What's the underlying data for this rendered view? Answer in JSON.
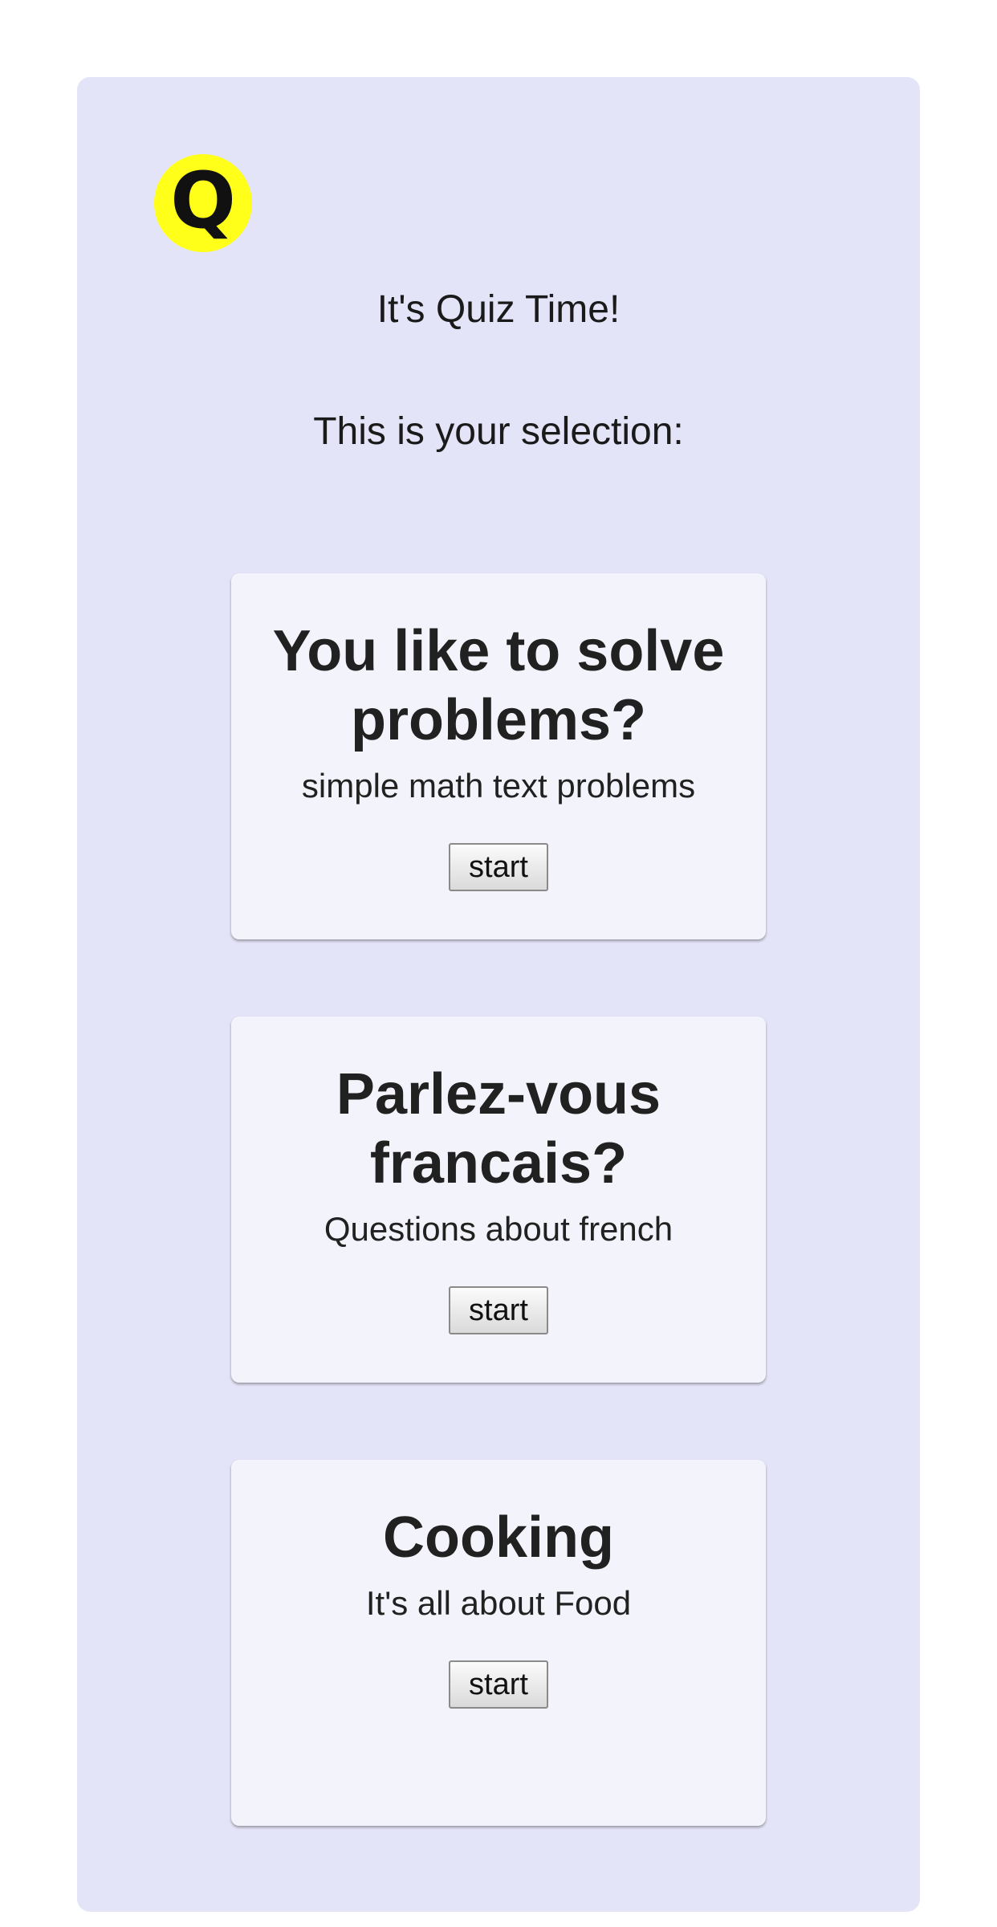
{
  "header": {
    "logo_letter": "Q",
    "title": "It's Quiz Time!",
    "subtitle": "This is your selection:"
  },
  "quizzes": [
    {
      "title": "You like to solve problems?",
      "description": "simple math text problems",
      "button_label": "start"
    },
    {
      "title": "Parlez-vous francais?",
      "description": "Questions about french",
      "button_label": "start"
    },
    {
      "title": "Cooking",
      "description": "It's all about Food",
      "button_label": "start"
    }
  ],
  "colors": {
    "panel_background": "#e4e4f8",
    "card_background": "#f3f3fb",
    "logo_background": "#ffff1a"
  }
}
